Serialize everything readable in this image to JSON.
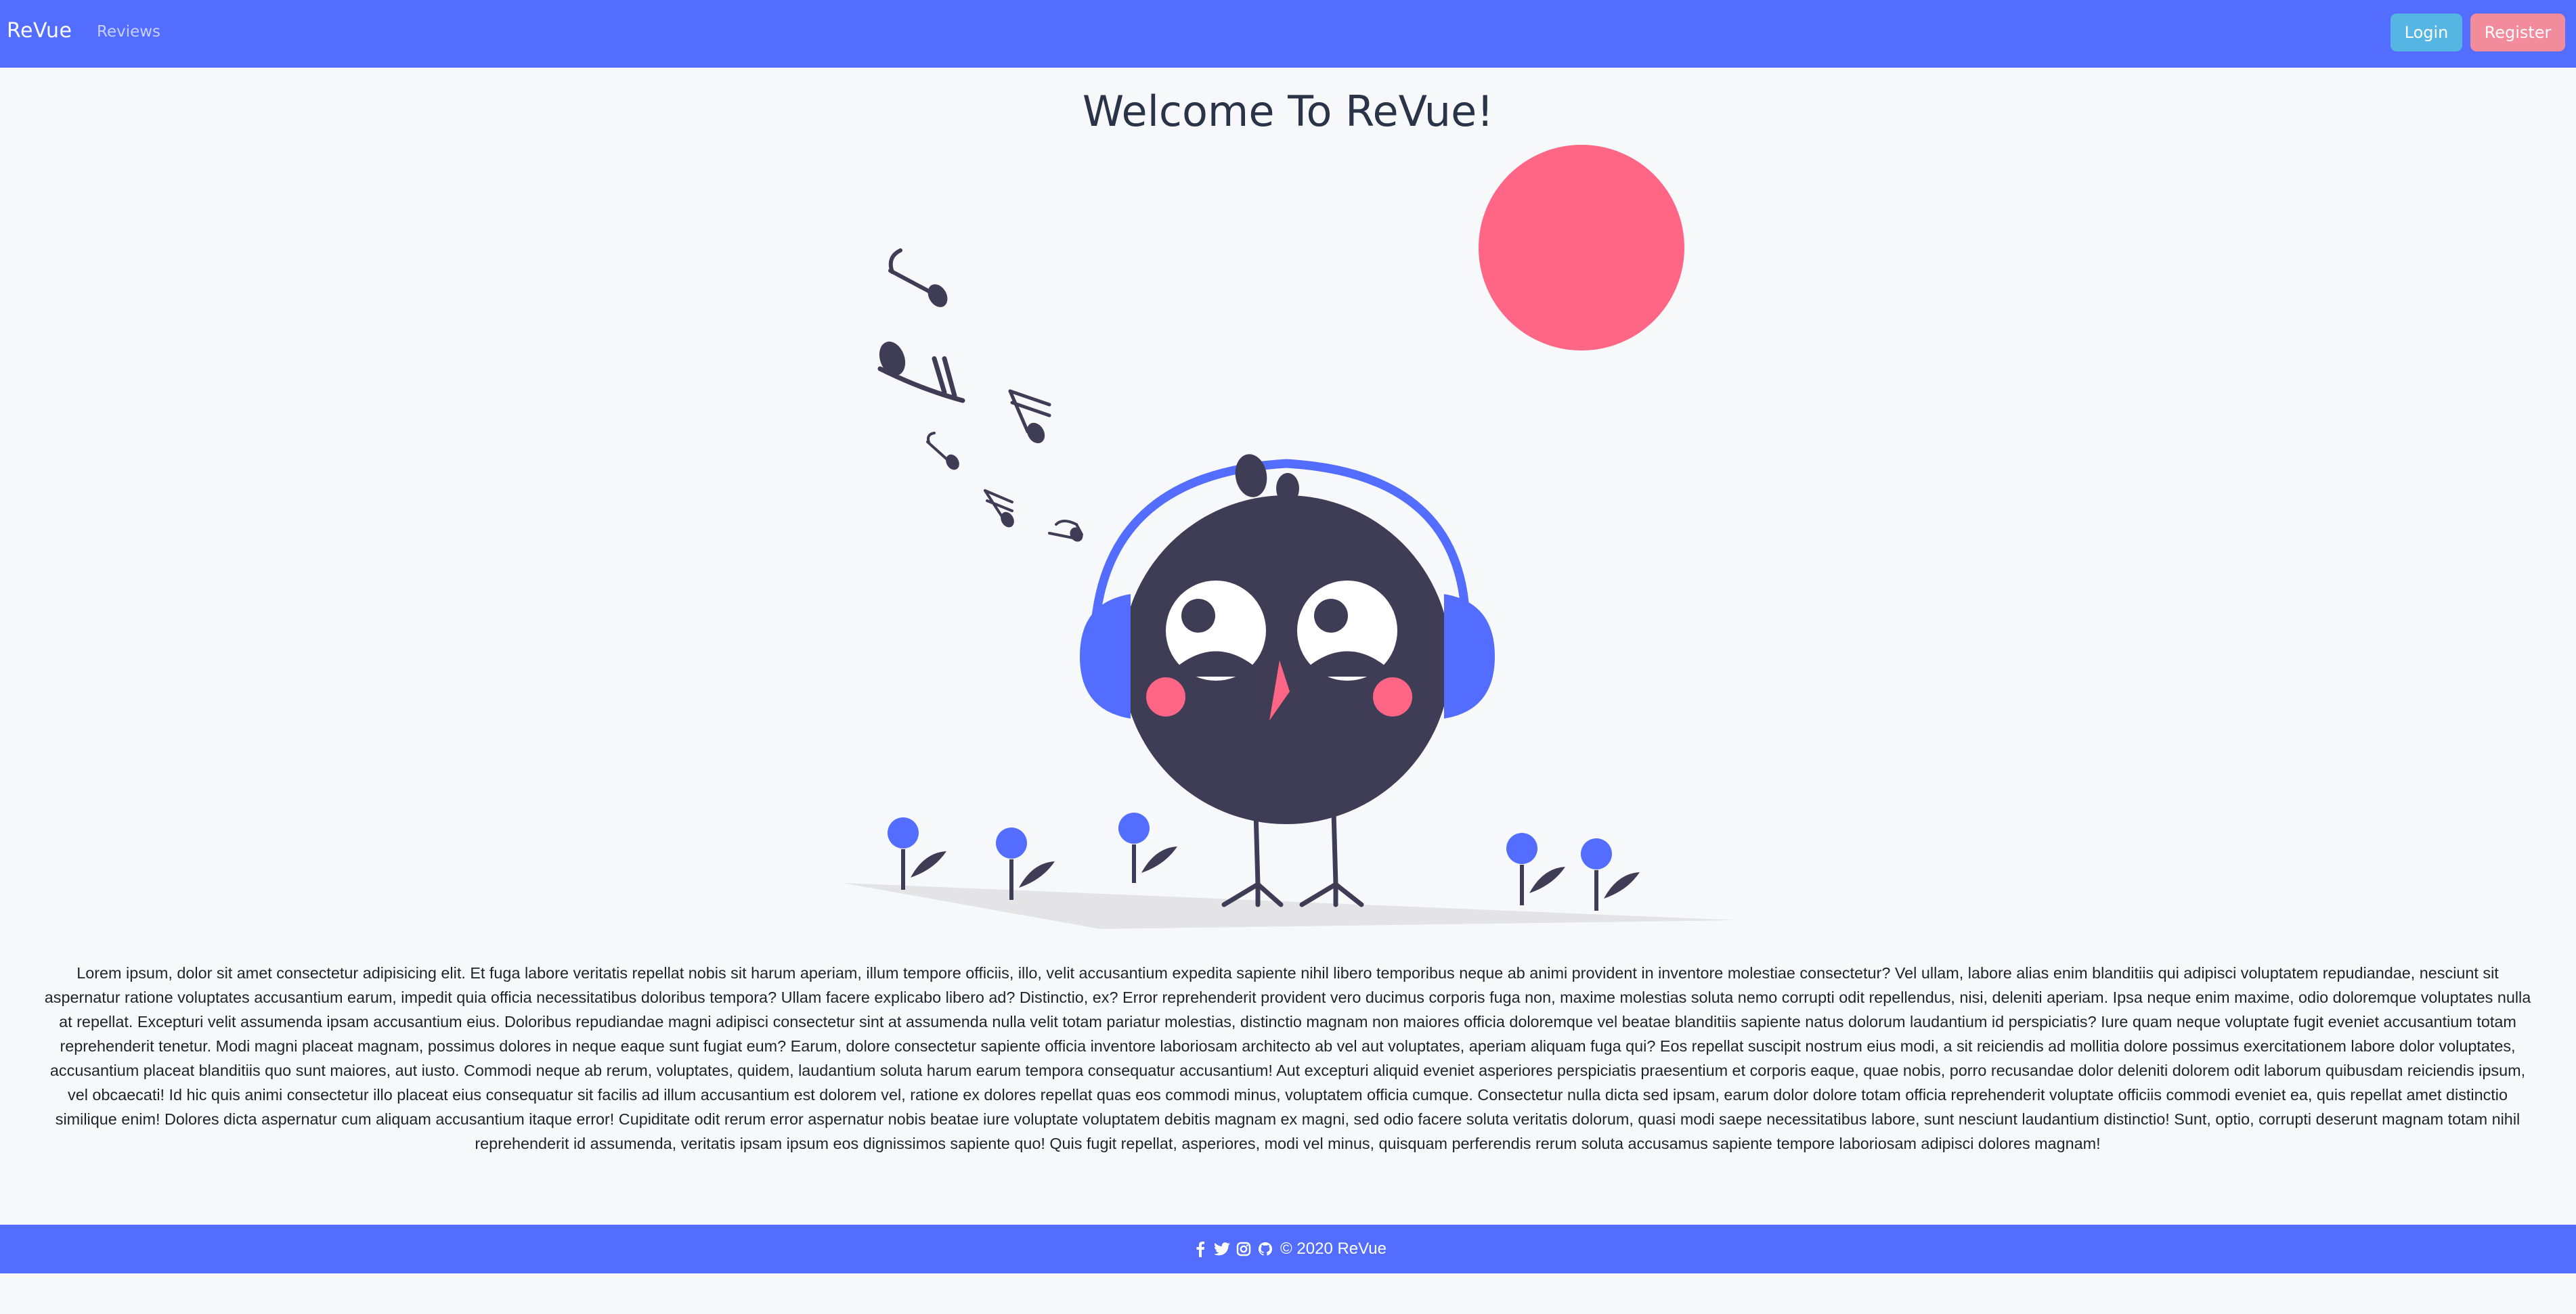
{
  "navbar": {
    "brand": "ReVue",
    "links": [
      {
        "label": "Reviews"
      }
    ],
    "login_label": "Login",
    "register_label": "Register"
  },
  "main": {
    "heading": "Welcome To ReVue!",
    "illustration_icon": "bird-with-headphones-illustration",
    "paragraph": "Lorem ipsum, dolor sit amet consectetur adipisicing elit. Et fuga labore veritatis repellat nobis sit harum aperiam, illum tempore officiis, illo, velit accusantium expedita sapiente nihil libero temporibus neque ab animi provident in inventore molestiae consectetur? Vel ullam, labore alias enim blanditiis qui adipisci voluptatem repudiandae, nesciunt sit aspernatur ratione voluptates accusantium earum, impedit quia officia necessitatibus doloribus tempora? Ullam facere explicabo libero ad? Distinctio, ex? Error reprehenderit provident vero ducimus corporis fuga non, maxime molestias soluta nemo corrupti odit repellendus, nisi, deleniti aperiam. Ipsa neque enim maxime, odio doloremque voluptates nulla at repellat. Excepturi velit assumenda ipsam accusantium eius. Doloribus repudiandae magni adipisci consectetur sint at assumenda nulla velit totam pariatur molestias, distinctio magnam non maiores officia doloremque vel beatae blanditiis sapiente natus dolorum laudantium id perspiciatis? Iure quam neque voluptate fugit eveniet accusantium totam reprehenderit tenetur. Modi magni placeat magnam, possimus dolores in neque eaque sunt fugiat eum? Earum, dolore consectetur sapiente officia inventore laboriosam architecto ab vel aut voluptates, aperiam aliquam fuga qui? Eos repellat suscipit nostrum eius modi, a sit reiciendis ad mollitia dolore possimus exercitationem labore dolor voluptates, accusantium placeat blanditiis quo sunt maiores, aut iusto. Commodi neque ab rerum, voluptates, quidem, laudantium soluta harum earum tempora consequatur accusantium! Aut excepturi aliquid eveniet asperiores perspiciatis praesentium et corporis eaque, quae nobis, porro recusandae dolor deleniti dolorem odit laborum quibusdam reiciendis ipsum, vel obcaecati! Id hic quis animi consectetur illo placeat eius consequatur sit facilis ad illum accusantium est dolorem vel, ratione ex dolores repellat quas eos commodi minus, voluptatem officia cumque. Consectetur nulla dicta sed ipsam, earum dolor dolore totam officia reprehenderit voluptate officiis commodi eveniet ea, quis repellat amet distinctio similique enim! Dolores dicta aspernatur cum aliquam accusantium itaque error! Cupiditate odit rerum error aspernatur nobis beatae iure voluptate voluptatem debitis magnam ex magni, sed odio facere soluta veritatis dolorum, quasi modi saepe necessitatibus labore, sunt nesciunt laudantium distinctio! Sunt, optio, corrupti deserunt magnam totam nihil reprehenderit id assumenda, veritatis ipsam ipsum eos dignissimos sapiente quo! Quis fugit repellat, asperiores, modi vel minus, quisquam perferendis rerum soluta accusamus sapiente tempore laboriosam adipisci dolores magnam!"
  },
  "footer": {
    "social_icons": [
      "facebook-icon",
      "twitter-icon",
      "instagram-icon",
      "github-icon"
    ],
    "copyright": "© 2020 ReVue"
  },
  "colors": {
    "primary": "#526dff",
    "login_button": "#55b6e3",
    "register_button": "#f28b9b",
    "accent_pink": "#ff6584",
    "bird_body": "#3f3d56",
    "background": "#f7f8fa"
  }
}
